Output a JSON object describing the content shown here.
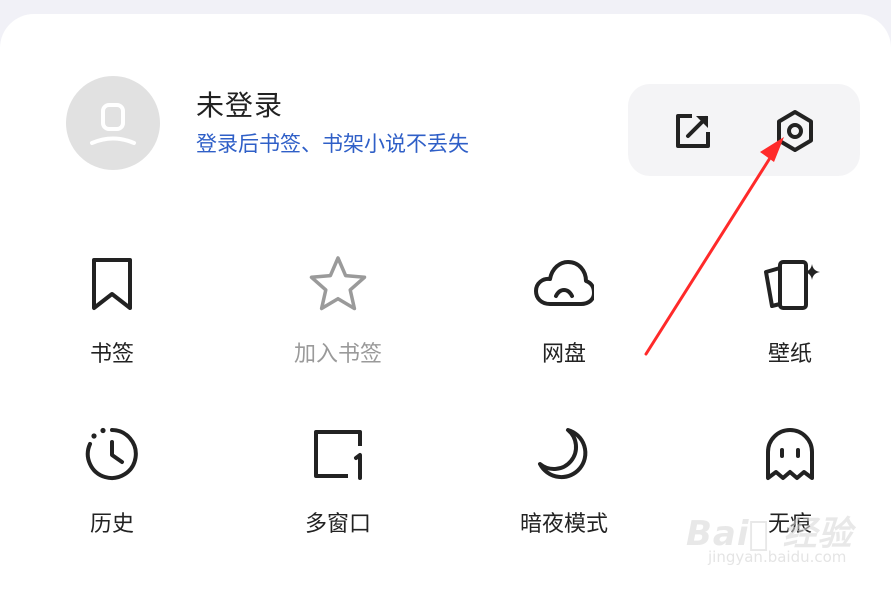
{
  "profile": {
    "status": "未登录",
    "subtitle": "登录后书签、书架小说不丢失"
  },
  "top_actions": [
    {
      "icon": "share-out-icon"
    },
    {
      "icon": "settings-hexagon-icon"
    }
  ],
  "grid": [
    {
      "label": "书签",
      "icon": "bookmark-icon",
      "enabled": true
    },
    {
      "label": "加入书签",
      "icon": "star-icon",
      "enabled": false
    },
    {
      "label": "网盘",
      "icon": "cloud-icon",
      "enabled": true
    },
    {
      "label": "壁纸",
      "icon": "wallpaper-icon",
      "enabled": true
    },
    {
      "label": "历史",
      "icon": "history-clock-icon",
      "enabled": true
    },
    {
      "label": "多窗口",
      "icon": "multi-window-icon",
      "enabled": true
    },
    {
      "label": "暗夜模式",
      "icon": "moon-icon",
      "enabled": true
    },
    {
      "label": "无痕",
      "icon": "ghost-icon",
      "enabled": true
    }
  ],
  "watermark": {
    "brand": "Bai⃝ 经验",
    "domain": "jingyan.baidu.com"
  },
  "colors": {
    "accent_link": "#2f5fc7",
    "annotation_arrow": "#ff2a2a",
    "disabled": "#9a9a9a"
  }
}
